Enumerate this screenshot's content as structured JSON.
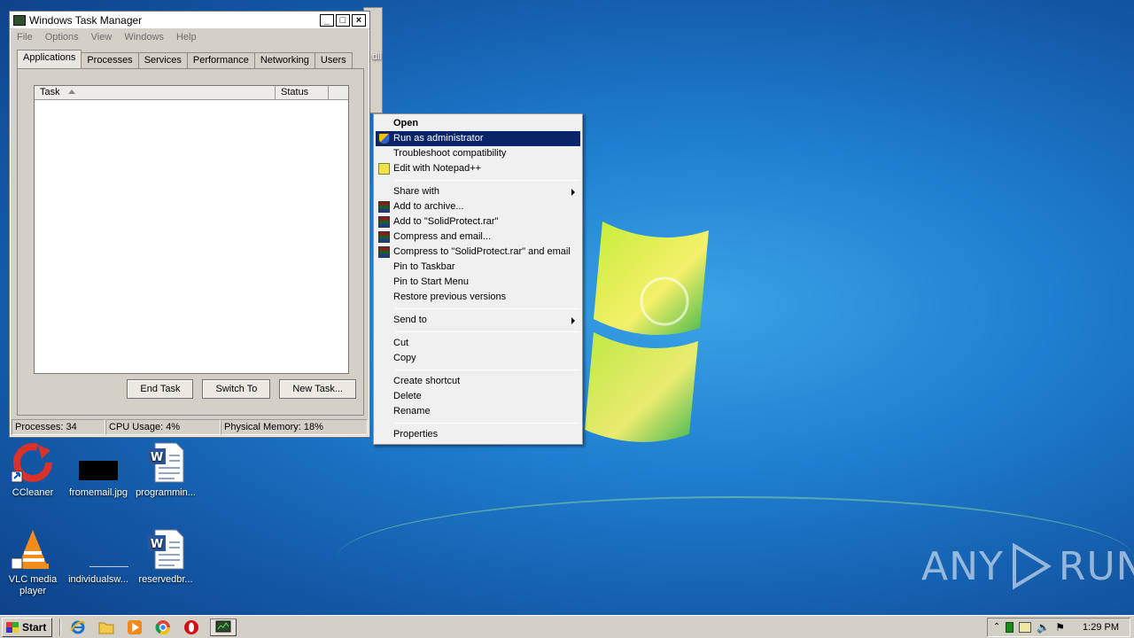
{
  "taskmanager": {
    "title": "Windows Task Manager",
    "menu": [
      "File",
      "Options",
      "View",
      "Windows",
      "Help"
    ],
    "tabs": [
      "Applications",
      "Processes",
      "Services",
      "Performance",
      "Networking",
      "Users"
    ],
    "active_tab": "Applications",
    "columns": {
      "task": "Task",
      "status": "Status"
    },
    "buttons": {
      "end_task": "End Task",
      "switch_to": "Switch To",
      "new_task": "New Task..."
    },
    "status": {
      "processes": "Processes: 34",
      "cpu": "CPU Usage: 4%",
      "memory": "Physical Memory: 18%"
    },
    "title_buttons": {
      "minimize": "_",
      "maximize": "□",
      "close": "×"
    }
  },
  "background_window": {
    "label": "dll"
  },
  "context_menu": {
    "items": [
      {
        "label": "Open",
        "bold": true
      },
      {
        "label": "Run as administrator",
        "icon": "shield-icon",
        "highlighted": true
      },
      {
        "label": "Troubleshoot compatibility"
      },
      {
        "label": "Edit with Notepad++",
        "icon": "notepad-plus-plus-icon"
      },
      {
        "label": "Share with",
        "submenu": true
      },
      {
        "label": "Add to archive...",
        "icon": "winrar-icon"
      },
      {
        "label": "Add to \"SolidProtect.rar\"",
        "icon": "winrar-icon"
      },
      {
        "label": "Compress and email...",
        "icon": "winrar-icon"
      },
      {
        "label": "Compress to \"SolidProtect.rar\" and email",
        "icon": "winrar-icon"
      },
      {
        "label": "Pin to Taskbar"
      },
      {
        "label": "Pin to Start Menu"
      },
      {
        "label": "Restore previous versions"
      },
      {
        "label": "Send to",
        "submenu": true
      },
      {
        "label": "Cut"
      },
      {
        "label": "Copy"
      },
      {
        "label": "Create shortcut"
      },
      {
        "label": "Delete"
      },
      {
        "label": "Rename"
      },
      {
        "label": "Properties"
      }
    ]
  },
  "desktop_icons": [
    {
      "label": "CCleaner",
      "icon": "ccleaner-icon"
    },
    {
      "label": "fromemail.jpg",
      "icon": "image-file-icon"
    },
    {
      "label": "programmin...",
      "icon": "word-document-icon"
    },
    {
      "label": "VLC media player",
      "icon": "vlc-icon"
    },
    {
      "label": "individualsw...",
      "icon": "blank-file-icon"
    },
    {
      "label": "reservedbr...",
      "icon": "word-document-icon"
    }
  ],
  "taskbar": {
    "start_label": "Start",
    "pinned": [
      "internet-explorer-icon",
      "explorer-folder-icon",
      "media-player-icon",
      "chrome-icon",
      "opera-icon",
      "task-manager-icon"
    ],
    "tray_icons": [
      "show-hidden-icons-icon",
      "network-status-icon",
      "action-center-icon",
      "volume-icon",
      "flag-icon"
    ],
    "clock": "1:29 PM"
  },
  "watermark": {
    "text_left": "ANY",
    "text_right": "RUN"
  }
}
